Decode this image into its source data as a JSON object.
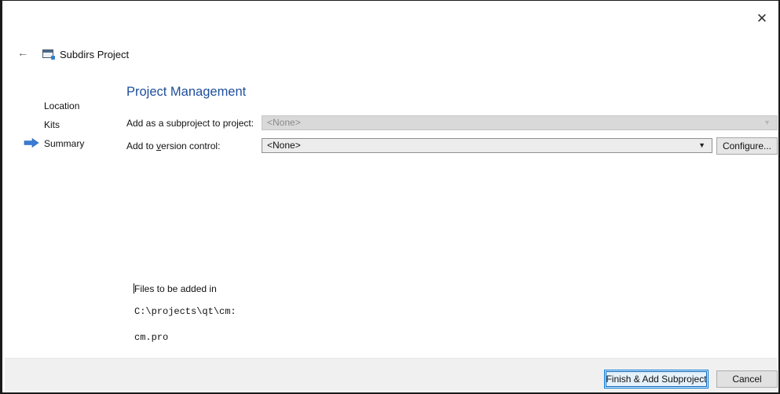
{
  "window": {
    "close_glyph": "✕",
    "back_glyph": "←",
    "title": "Subdirs Project"
  },
  "steps": [
    {
      "label": "Location",
      "current": false
    },
    {
      "label": "Kits",
      "current": false
    },
    {
      "label": "Summary",
      "current": true
    }
  ],
  "section": {
    "title": "Project Management"
  },
  "form": {
    "subproject_label": "Add as a subproject to project:",
    "subproject_value": "<None>",
    "vcs_label_pre": "Add to ",
    "vcs_label_accel": "v",
    "vcs_label_post": "ersion control:",
    "vcs_value": "<None>",
    "configure_label": "Configure..."
  },
  "files": {
    "heading": "Files to be added in",
    "path": "C:\\projects\\qt\\cm:",
    "file": "cm.pro"
  },
  "footer": {
    "finish_label": "Finish & Add Subproject",
    "cancel_label": "Cancel"
  },
  "colors": {
    "section_title": "#1f4e9c",
    "current_step_arrow": "#3a7bd5",
    "focus_border": "#0078d7"
  }
}
